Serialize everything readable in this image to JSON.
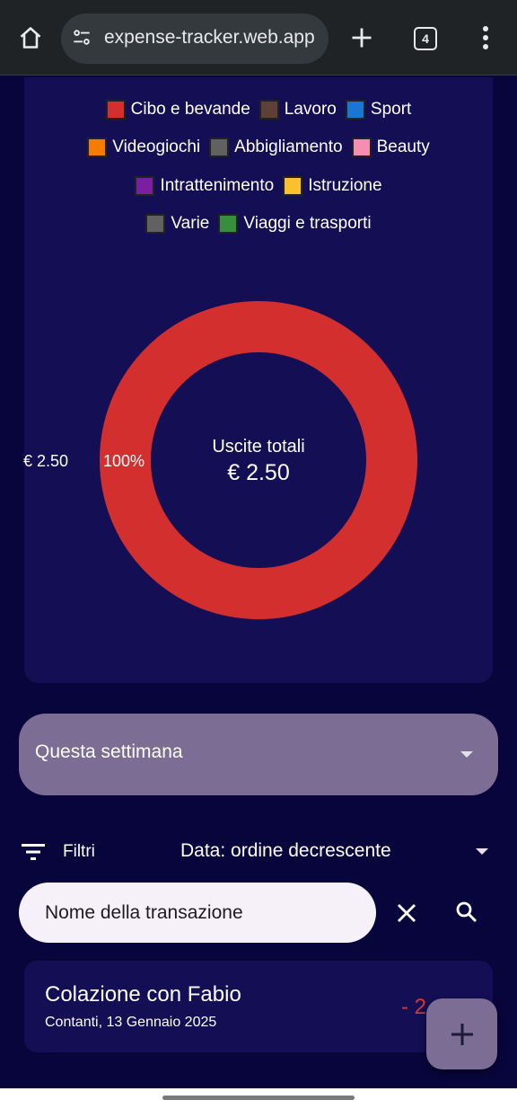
{
  "browser": {
    "url": "expense-tracker.web.app",
    "tab_count": "4"
  },
  "chart_data": {
    "type": "pie",
    "categories": [
      "Cibo e bevande"
    ],
    "values": [
      2.5
    ],
    "center_title": "Uscite totali",
    "center_value": "€ 2.50",
    "slice_value_label": "€ 2.50",
    "slice_percent_label": "100%",
    "legend": [
      {
        "label": "Cibo e bevande",
        "color": "#d32f2f"
      },
      {
        "label": "Lavoro",
        "color": "#5d4037"
      },
      {
        "label": "Sport",
        "color": "#1976d2"
      },
      {
        "label": "Videogiochi",
        "color": "#f57c00"
      },
      {
        "label": "Abbigliamento",
        "color": "#616161"
      },
      {
        "label": "Beauty",
        "color": "#f48fb1"
      },
      {
        "label": "Intrattenimento",
        "color": "#7b1fa2"
      },
      {
        "label": "Istruzione",
        "color": "#fbc02d"
      },
      {
        "label": "Varie",
        "color": "#616161"
      },
      {
        "label": "Viaggi e trasporti",
        "color": "#388e3c"
      }
    ],
    "legend_rows": [
      [
        0,
        1,
        2
      ],
      [
        3,
        4,
        5
      ],
      [
        6,
        7
      ],
      [
        8,
        9
      ]
    ],
    "legend_placement": "top"
  },
  "period": {
    "selected": "Questa settimana"
  },
  "filters": {
    "label": "Filtri",
    "sort": "Data: ordine decrescente"
  },
  "search": {
    "value": "Nome della transazione"
  },
  "transactions": [
    {
      "title": "Colazione con Fabio",
      "subtitle": "Contanti,  13 Gennaio 2025",
      "amount": "- 2"
    }
  ],
  "colors": {
    "background": "#08053c",
    "card": "#140e55",
    "accent": "#7b6d93",
    "expense": "#d33a33"
  }
}
